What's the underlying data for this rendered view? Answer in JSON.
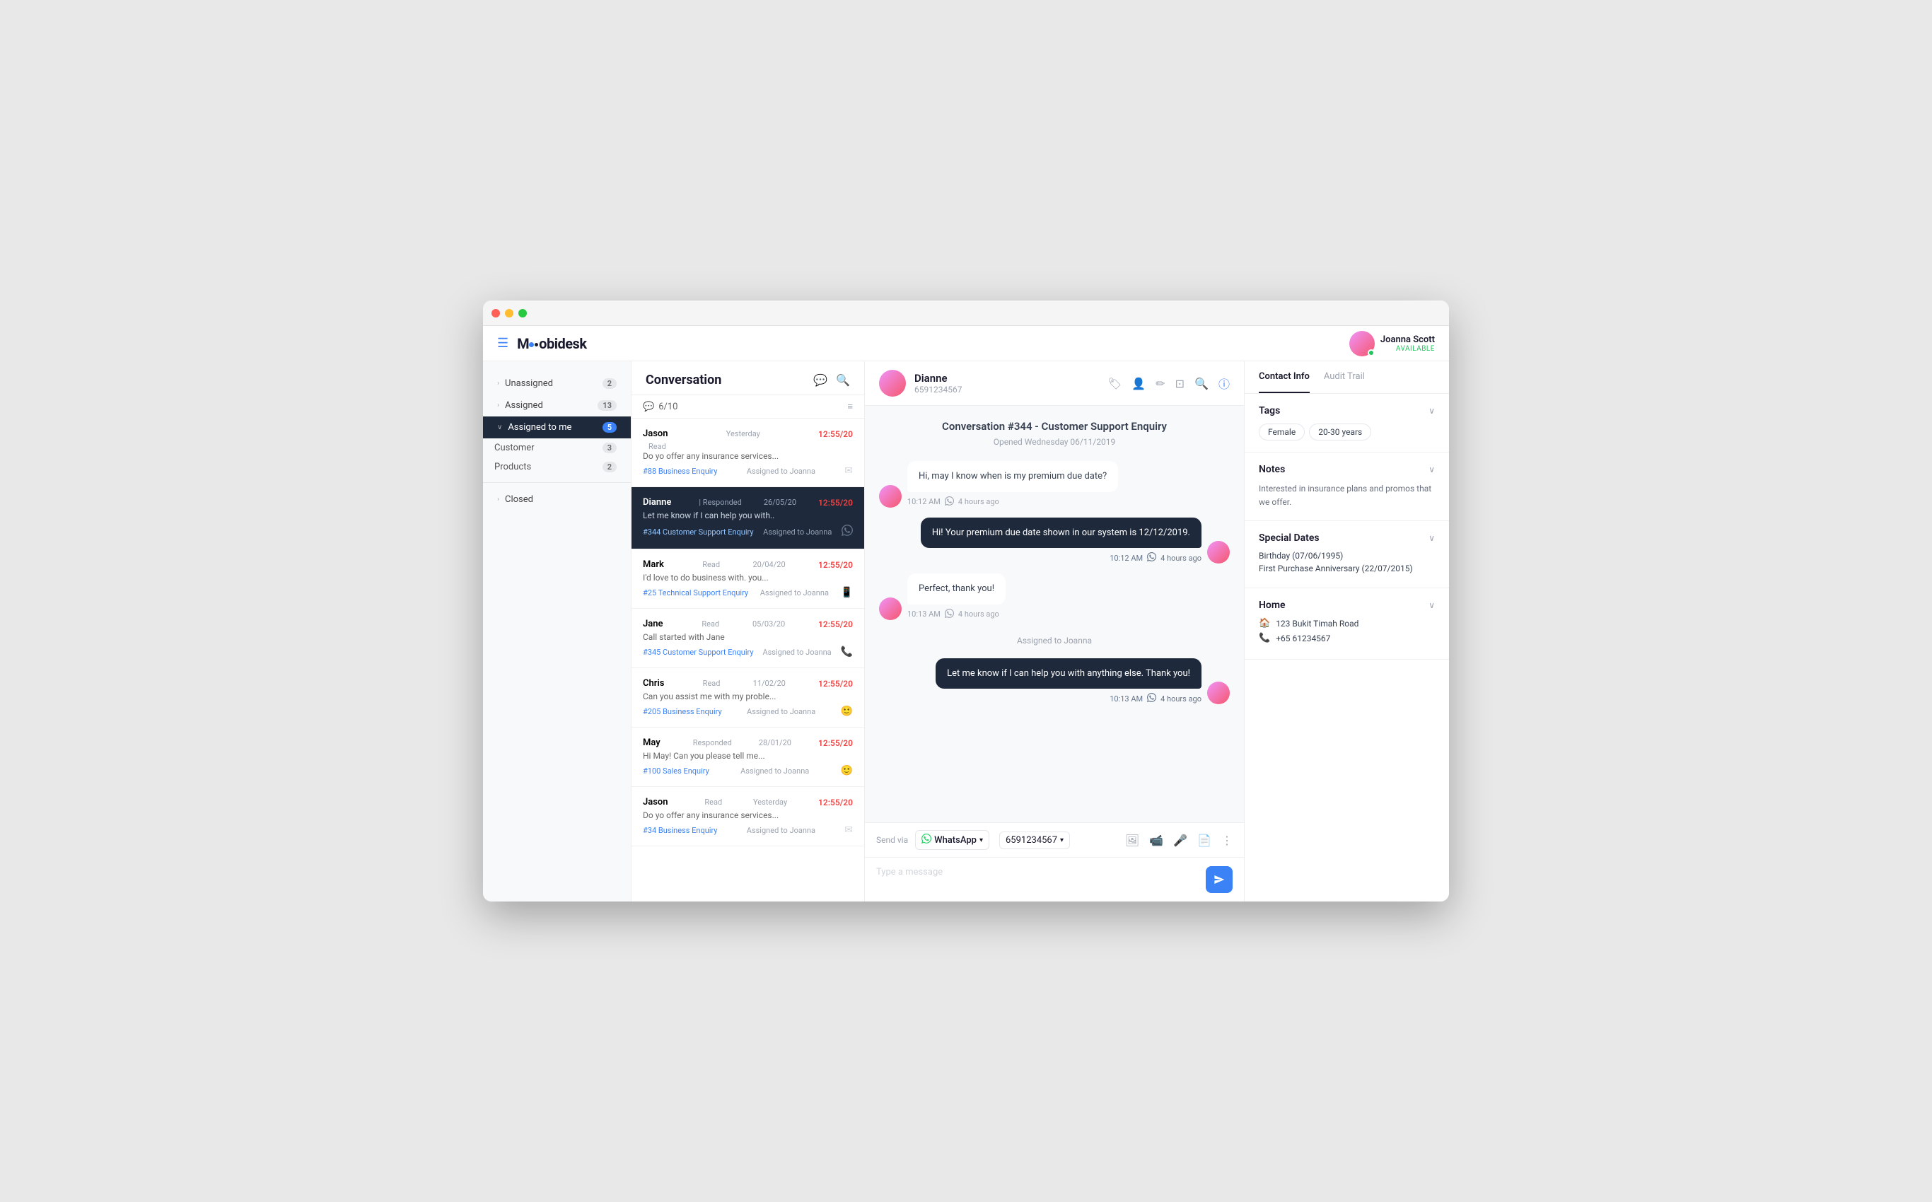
{
  "window": {
    "title": "Moobidesk"
  },
  "topnav": {
    "logo": "Moobidesk",
    "user": {
      "name": "Joanna Scott",
      "status": "AVAILABLE"
    }
  },
  "sidebar": {
    "items": [
      {
        "id": "unassigned",
        "label": "Unassigned",
        "count": "2",
        "expanded": false
      },
      {
        "id": "assigned",
        "label": "Assigned",
        "count": "13",
        "expanded": false
      },
      {
        "id": "assigned-to-me",
        "label": "Assigned to me",
        "count": "5",
        "expanded": true,
        "active": true
      },
      {
        "id": "customer",
        "label": "Customer",
        "count": "3",
        "sub": true
      },
      {
        "id": "products",
        "label": "Products",
        "count": "2",
        "sub": true
      },
      {
        "id": "closed",
        "label": "Closed",
        "count": "",
        "expanded": false
      }
    ]
  },
  "convList": {
    "title": "Conversation",
    "count": "6/10",
    "items": [
      {
        "id": 1,
        "name": "Jason",
        "status": "Read",
        "date": "Yesterday",
        "time": "12:55/20",
        "preview": "Do yo offer any insurance services...",
        "tag": "#88 Business Enquiry",
        "assigned": "Assigned to Joanna",
        "channel": "email",
        "selected": false
      },
      {
        "id": 2,
        "name": "Dianne",
        "status": "Responded",
        "date": "26/05/20",
        "time": "12:55/20",
        "preview": "Let me know if I can help you with..",
        "tag": "#344 Customer Support Enquiry",
        "assigned": "Assigned to Joanna",
        "channel": "whatsapp",
        "selected": true
      },
      {
        "id": 3,
        "name": "Mark",
        "status": "Read",
        "date": "20/04/20",
        "time": "12:55/20",
        "preview": "I'd love to do business with. you...",
        "tag": "#25 Technical Support Enquiry",
        "assigned": "Assigned to Joanna",
        "channel": "phone",
        "selected": false
      },
      {
        "id": 4,
        "name": "Jane",
        "status": "Read",
        "date": "05/03/20",
        "time": "12:55/20",
        "preview": "Call started with Jane",
        "tag": "#345 Customer Support Enquiry",
        "assigned": "Assigned to Joanna",
        "channel": "phone",
        "selected": false
      },
      {
        "id": 5,
        "name": "Chris",
        "status": "Read",
        "date": "11/02/20",
        "time": "12:55/20",
        "preview": "Can you assist me with my proble...",
        "tag": "#205 Business Enquiry",
        "assigned": "Assigned to Joanna",
        "channel": "smiley",
        "selected": false
      },
      {
        "id": 6,
        "name": "May",
        "status": "Responded",
        "date": "28/01/20",
        "time": "12:55/20",
        "preview": "Hi May! Can you please tell me...",
        "tag": "#100 Sales Enquiry",
        "assigned": "Assigned to Joanna",
        "channel": "smiley",
        "selected": false
      },
      {
        "id": 7,
        "name": "Jason",
        "status": "Read",
        "date": "Yesterday",
        "time": "12:55/20",
        "preview": "Do yo offer any insurance services...",
        "tag": "#34 Business Enquiry",
        "assigned": "Assigned to Joanna",
        "channel": "email",
        "selected": false
      }
    ]
  },
  "chat": {
    "contactName": "Dianne",
    "contactPhone": "6591234567",
    "convTitle": "Conversation #344 - Customer Support Enquiry",
    "convSubtitle": "Opened Wednesday 06/11/2019",
    "assignedBanner": "Assigned to Joanna",
    "messages": [
      {
        "id": 1,
        "type": "incoming",
        "text": "Hi, may I know when is my premium due date?",
        "time": "10:12 AM",
        "ago": "4 hours ago",
        "channel": "whatsapp"
      },
      {
        "id": 2,
        "type": "outgoing",
        "text": "Hi! Your premium due date shown in our system is 12/12/2019.",
        "time": "10:12 AM",
        "ago": "4 hours ago",
        "channel": "whatsapp"
      },
      {
        "id": 3,
        "type": "incoming",
        "text": "Perfect, thank you!",
        "time": "10:13 AM",
        "ago": "4 hours ago",
        "channel": "whatsapp"
      },
      {
        "id": 4,
        "type": "outgoing",
        "text": "Let me know if I can help you with anything else. Thank you!",
        "time": "10:13 AM",
        "ago": "4 hours ago",
        "channel": "whatsapp"
      }
    ],
    "input": {
      "placeholder": "Type a message",
      "sendVia": "WhatsApp",
      "phoneNumber": "6591234567"
    }
  },
  "contactPanel": {
    "tabs": [
      {
        "id": "contact-info",
        "label": "Contact Info",
        "active": true
      },
      {
        "id": "audit-trail",
        "label": "Audit Trail",
        "active": false
      }
    ],
    "tags": {
      "title": "Tags",
      "items": [
        "Female",
        "20-30 years"
      ]
    },
    "notes": {
      "title": "Notes",
      "text": "Interested in insurance plans and promos that we offer."
    },
    "specialDates": {
      "title": "Special Dates",
      "items": [
        "Birthday (07/06/1995)",
        "First Purchase Anniversary (22/07/2015)"
      ]
    },
    "home": {
      "title": "Home",
      "address": "123 Bukit Timah Road",
      "phone": "+65 61234567"
    }
  }
}
